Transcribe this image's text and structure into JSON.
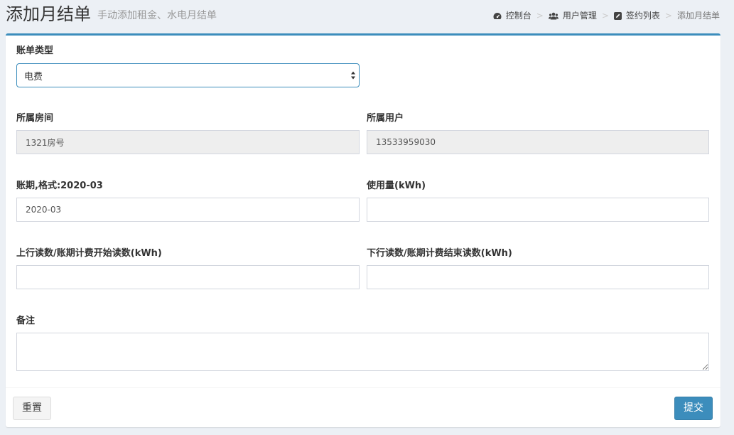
{
  "header": {
    "title": "添加月结单",
    "subtitle": "手动添加租金、水电月结单"
  },
  "breadcrumb": [
    {
      "label": "控制台",
      "icon": "dashboard-icon"
    },
    {
      "label": "用户管理",
      "icon": "users-icon"
    },
    {
      "label": "签约列表",
      "icon": "edit-icon"
    },
    {
      "label": "添加月结单"
    }
  ],
  "breadcrumb_separator": ">",
  "form": {
    "bill_type": {
      "label": "账单类型",
      "value": "电费"
    },
    "room": {
      "label": "所属房间",
      "value": "1321房号"
    },
    "user": {
      "label": "所属用户",
      "value": "13533959030"
    },
    "period": {
      "label": "账期,格式:2020-03",
      "value": "2020-03"
    },
    "usage": {
      "label": "使用量(kWh)",
      "value": ""
    },
    "start_reading": {
      "label": "上行读数/账期计费开始读数(kWh)",
      "value": ""
    },
    "end_reading": {
      "label": "下行读数/账期计费结束读数(kWh)",
      "value": ""
    },
    "remark": {
      "label": "备注",
      "value": ""
    }
  },
  "footer": {
    "reset_label": "重置",
    "submit_label": "提交"
  },
  "colors": {
    "accent": "#3c8dbc",
    "background": "#ecf0f5"
  }
}
